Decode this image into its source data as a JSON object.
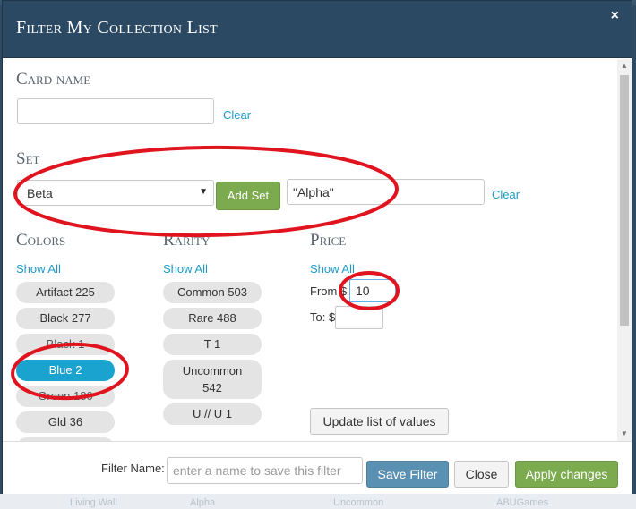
{
  "modal": {
    "title": "Filter My Collection List",
    "close_label": "×"
  },
  "card_name": {
    "label": "Card name",
    "value": "",
    "clear_label": "Clear"
  },
  "set": {
    "label": "Set",
    "selected": "Beta",
    "add_label": "Add Set",
    "value": "\"Alpha\"",
    "clear_label": "Clear"
  },
  "colors": {
    "label": "Colors",
    "show_all": "Show All",
    "items": [
      "Artifact 225",
      "Black 277",
      "Black 1",
      "Blue 2",
      "Green 180",
      "Gld 36"
    ]
  },
  "rarity": {
    "label": "Rarity",
    "show_all": "Show All",
    "items": [
      "Common 503",
      "Rare 488",
      "T 1",
      "Uncommon 542",
      "U // U 1"
    ]
  },
  "price": {
    "label": "Price",
    "show_all": "Show All",
    "from_label": "From $",
    "from_value": "10",
    "to_label": "To: $",
    "to_value": "",
    "update_label": "Update list of values"
  },
  "footer": {
    "filter_name_label": "Filter Name:",
    "filter_name_placeholder": "enter a name to save this filter",
    "save_label": "Save Filter",
    "close_label": "Close",
    "apply_label": "Apply changes"
  },
  "background": {
    "row_texts": [
      "Living Wall",
      "Alpha",
      "Uncommon",
      "ABUGames"
    ]
  },
  "colors_theme": {
    "header": "#2c4964",
    "accent": "#1aa3cf",
    "green": "#7bab4e",
    "save_blue": "#5a90b2",
    "annotation_red": "#e0141e"
  }
}
